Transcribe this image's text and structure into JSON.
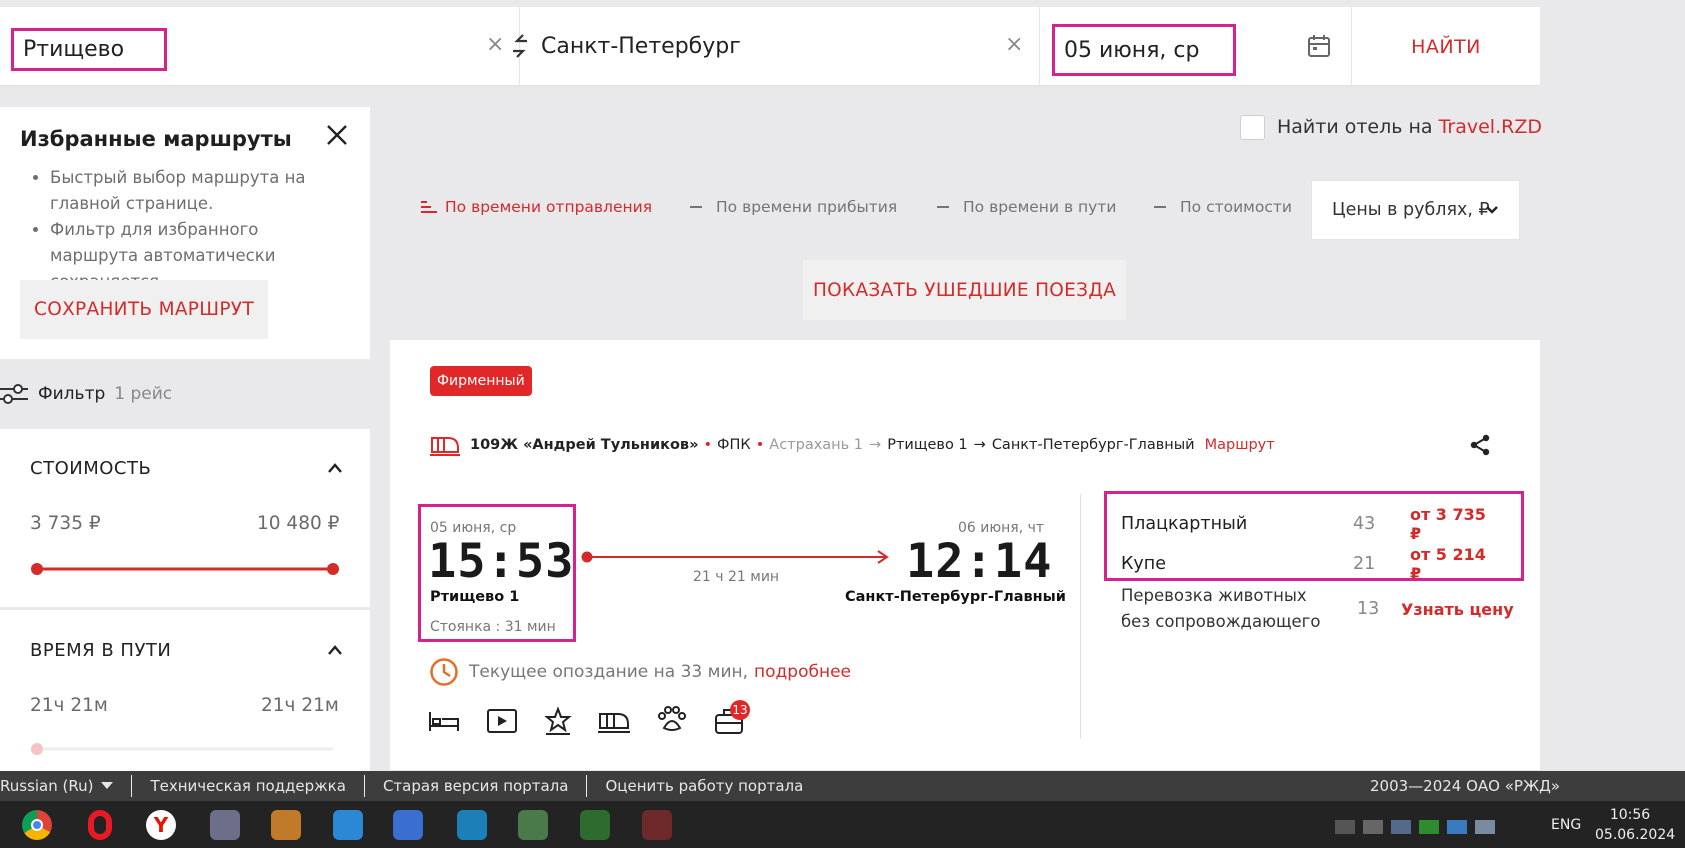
{
  "search": {
    "from": "Ртищево",
    "to": "Санкт-Петербург",
    "date": "05 июня, ср",
    "find_label": "НАЙТИ",
    "clear_glyph": "×"
  },
  "favorites": {
    "title": "Избранные маршруты",
    "items": [
      "Быстрый выбор маршрута на главной странице.",
      "Фильтр для избранного маршрута автоматически сохраняется."
    ],
    "save_label": "СОХРАНИТЬ МАРШРУТ"
  },
  "filter": {
    "label": "Фильтр",
    "count": "1 рейс",
    "cost": {
      "title": "СТОИМОСТЬ",
      "min": "3 735 ₽",
      "max": "10 480 ₽"
    },
    "travel_time": {
      "title": "ВРЕМЯ В ПУТИ",
      "min": "21ч 21м",
      "max": "21ч 21м"
    }
  },
  "hotel": {
    "label": "Найти отель на ",
    "link": "Travel.RZD",
    "checked": false
  },
  "sort": {
    "options": [
      {
        "label": "По времени отправления",
        "active": true
      },
      {
        "label": "По времени прибытия",
        "active": false
      },
      {
        "label": "По времени в пути",
        "active": false
      },
      {
        "label": "По стоимости",
        "active": false
      }
    ],
    "currency": "Цены в рублях, ₽"
  },
  "show_departed_label": "ПОКАЗАТЬ УШЕДШИЕ ПОЕЗДА",
  "train": {
    "badge": "Фирменный",
    "number_name": "109Ж «Андрей Тульников»",
    "carrier": "ФПК",
    "origin": "Астрахань 1",
    "from_station": "Ртищево 1",
    "to_station": "Санкт-Петербург-Главный",
    "route_link": "Маршрут",
    "departure": {
      "date": "05 июня, ср",
      "time": "15:53",
      "station": "Ртищево 1",
      "stop": "Стоянка : 31 мин"
    },
    "arrival": {
      "date": "06 июня, чт",
      "time": "12:14",
      "station": "Санкт-Петербург-Главный"
    },
    "duration": "21 ч 21 мин",
    "delay_text": "Текущее опоздание на 33 мин,",
    "delay_link": "подробнее",
    "luggage_badge": "13",
    "classes": [
      {
        "name": "Плацкартный",
        "seats": "43",
        "price": "от 3 735 ₽"
      },
      {
        "name": "Купе",
        "seats": "21",
        "price": "от 5 214 ₽"
      }
    ],
    "pets": {
      "name": "Перевозка животных без сопровождающего",
      "line1": "Перевозка животных",
      "line2": "без сопровождающего",
      "seats": "13",
      "price": "Узнать цену"
    }
  },
  "footer": {
    "language": "Russian  (Ru)",
    "links": [
      "Техническая поддержка",
      "Старая версия портала",
      "Оценить работу портала"
    ],
    "copyright": "2003—2024 ОАО «РЖД»"
  },
  "taskbar": {
    "lang": "ENG",
    "time": "10:56",
    "date": "05.06.2024"
  },
  "colors": {
    "accent": "#d42a2a",
    "highlight": "#d6218e",
    "badge": "#e02828"
  }
}
